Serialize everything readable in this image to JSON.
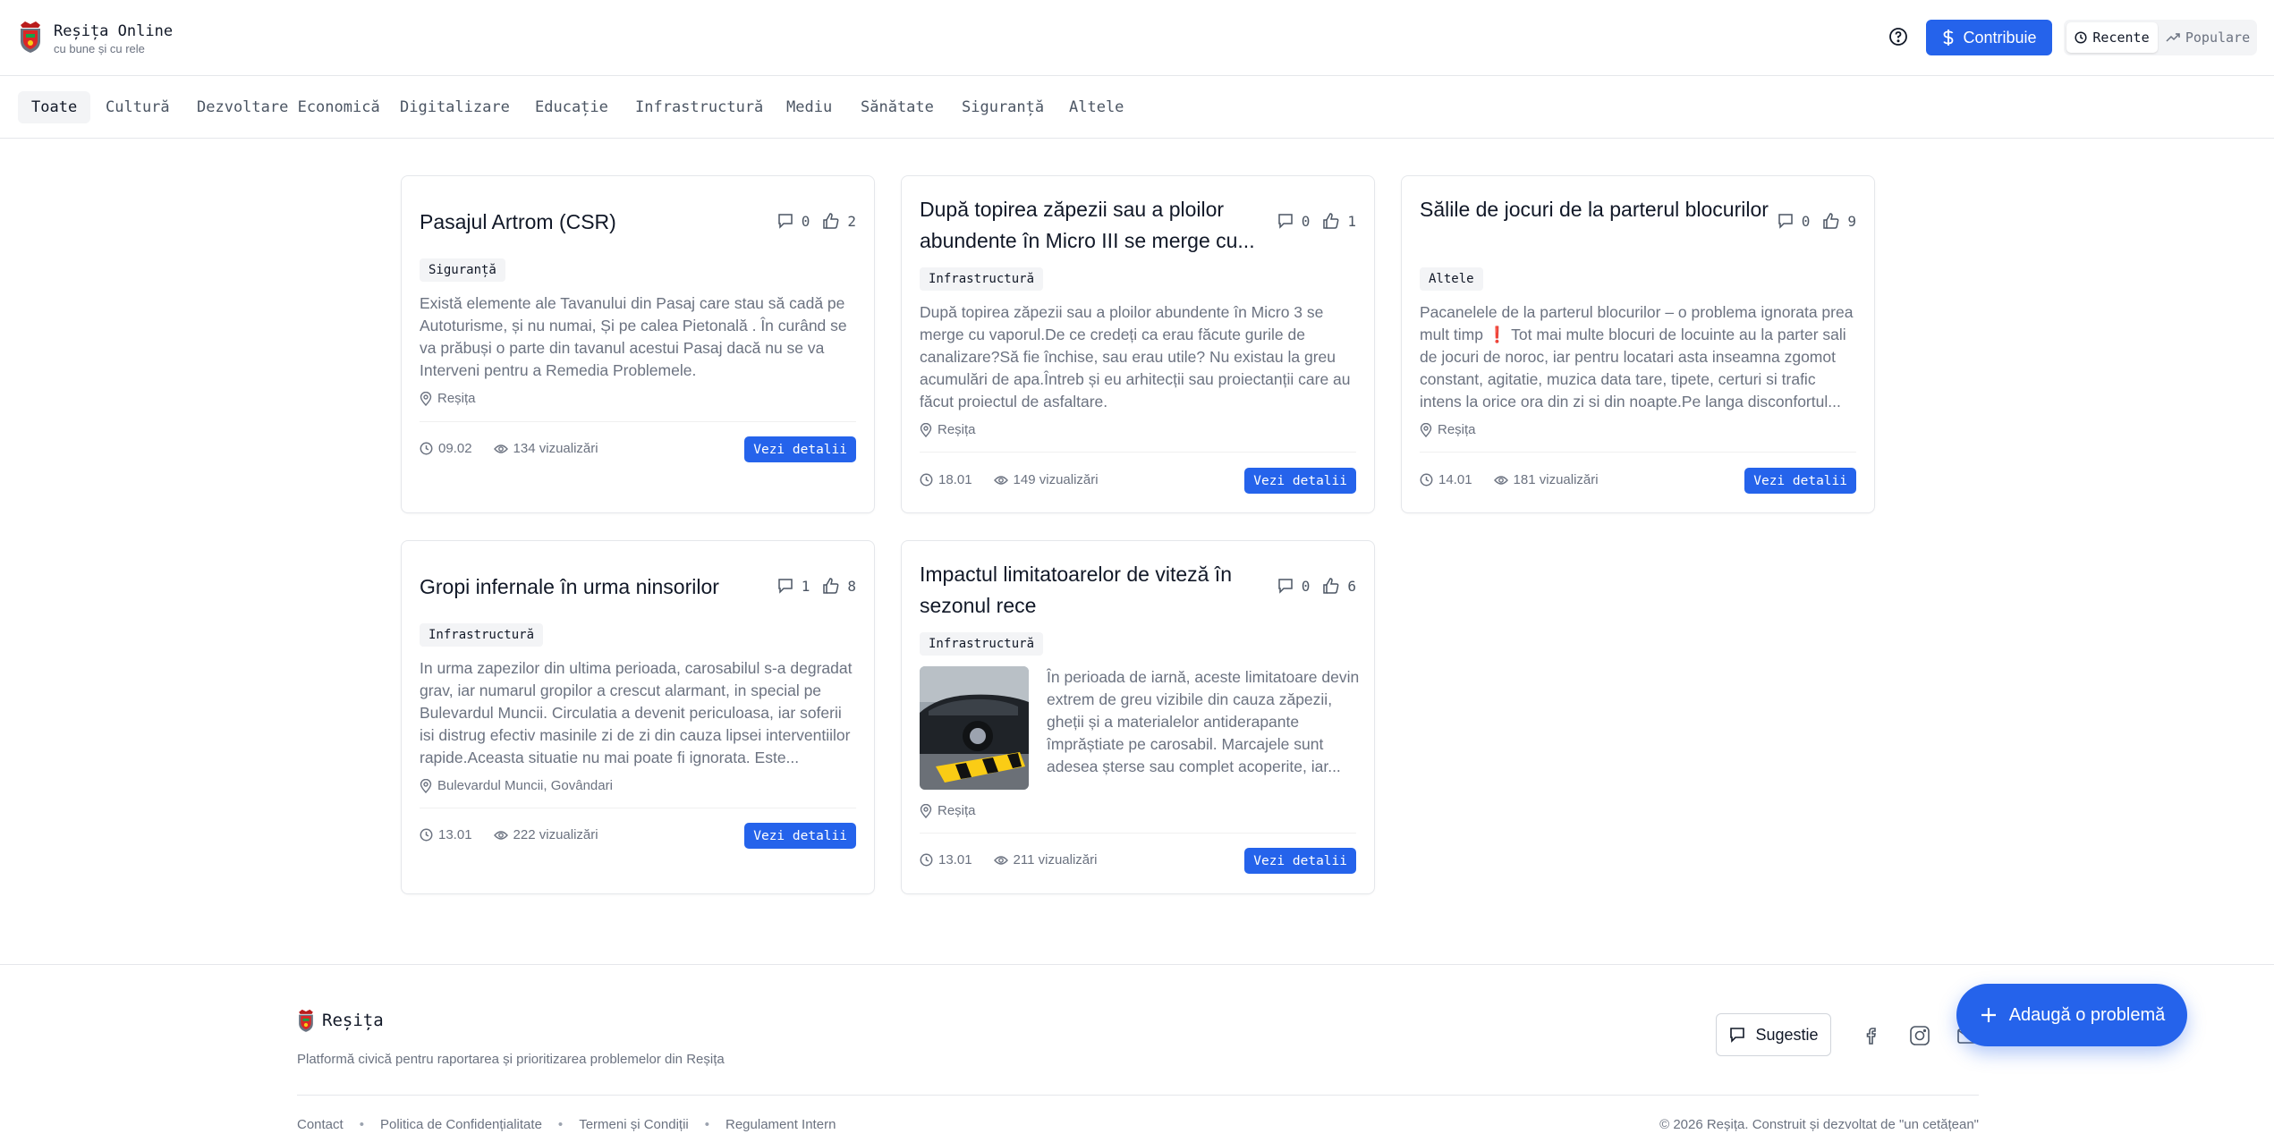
{
  "header": {
    "title": "Reșița Online",
    "subtitle": "cu bune și cu rele",
    "contribute_label": "Contribuie",
    "sort_recent": "Recente",
    "sort_popular": "Populare"
  },
  "categories": [
    "Toate",
    "Cultură",
    "Dezvoltare Economică",
    "Digitalizare",
    "Educație",
    "Infrastructură",
    "Mediu",
    "Sănătate",
    "Siguranță",
    "Altele"
  ],
  "active_category": "Toate",
  "cards": [
    {
      "title": "Pasajul Artrom (CSR)",
      "comments": "0",
      "likes": "2",
      "category": "Siguranță",
      "description": "Există elemente ale Tavanului din Pasaj care stau să cadă pe Autoturisme, și nu numai, Și pe calea Pietonală . În curând se va prăbuși o parte din tavanul acestui Pasaj dacă nu se va Interveni pentru a Remedia Problemele.",
      "location": "Reșița",
      "date": "09.02",
      "views": "134 vizualizări",
      "button": "Vezi detalii"
    },
    {
      "title": "După topirea zăpezii sau a ploilor abundente în Micro III se merge cu...",
      "comments": "0",
      "likes": "1",
      "category": "Infrastructură",
      "description": "După topirea zăpezii sau a ploilor abundente în Micro 3 se merge cu vaporul.De ce credeți ca erau făcute gurile de canalizare?Să fie închise, sau erau utile? Nu existau la greu acumulări de apa.Întreb și eu arhitecții sau proiectanții care au făcut proiectul de asfaltare.",
      "location": "Reșița",
      "date": "18.01",
      "views": "149 vizualizări",
      "button": "Vezi detalii"
    },
    {
      "title": "Sălile de jocuri de la parterul blocurilor",
      "comments": "0",
      "likes": "9",
      "category": "Altele",
      "description": "Pacanelele de la parterul blocurilor – o problema ignorata prea mult timp ❗ Tot mai multe blocuri de locuinte au la parter sali de jocuri de noroc, iar pentru locatari asta inseamna zgomot constant, agitatie, muzica data tare, tipete, certuri si trafic intens la orice ora din zi si din noapte.Pe langa disconfortul...",
      "location": "Reșița",
      "date": "14.01",
      "views": "181 vizualizări",
      "button": "Vezi detalii"
    },
    {
      "title": "Gropi infernale în urma ninsorilor",
      "comments": "1",
      "likes": "8",
      "category": "Infrastructură",
      "description": "In urma zapezilor din ultima perioada, carosabilul s-a degradat grav, iar numarul gropilor a crescut alarmant, in special pe Bulevardul Muncii. Circulatia a devenit periculoasa, iar soferii isi distrug efectiv masinile zi de zi din cauza lipsei interventiilor rapide.Aceasta situatie nu mai poate fi ignorata. Este...",
      "location": "Bulevardul Muncii, Govândari",
      "date": "13.01",
      "views": "222 vizualizări",
      "button": "Vezi detalii"
    },
    {
      "title": "Impactul limitatoarelor de viteză în sezonul rece",
      "comments": "0",
      "likes": "6",
      "category": "Infrastructură",
      "description": "În perioada de iarnă, aceste limitatoare devin extrem de greu vizibile din cauza zăpezii, gheții și a materialelor antiderapante împrăștiate pe carosabil. Marcajele sunt adesea șterse sau complet acoperite, iar...",
      "location": "Reșița",
      "date": "13.01",
      "views": "211 vizualizări",
      "button": "Vezi detalii"
    }
  ],
  "footer": {
    "brand": "Reșița",
    "description": "Platformă civică pentru raportarea și prioritizarea problemelor din Reșița",
    "links": [
      "Contact",
      "Politica de Confidențialitate",
      "Termeni și Condiții",
      "Regulament Intern"
    ],
    "copyright": "© 2026 Reșița. Construit și dezvoltat de \"un cetățean\"",
    "suggest_label": "Sugestie",
    "fab_label": "Adaugă o problemă"
  },
  "colors": {
    "accent": "#2563eb",
    "badge_bg": "#f3f4f6",
    "muted_text": "#6b7280"
  }
}
